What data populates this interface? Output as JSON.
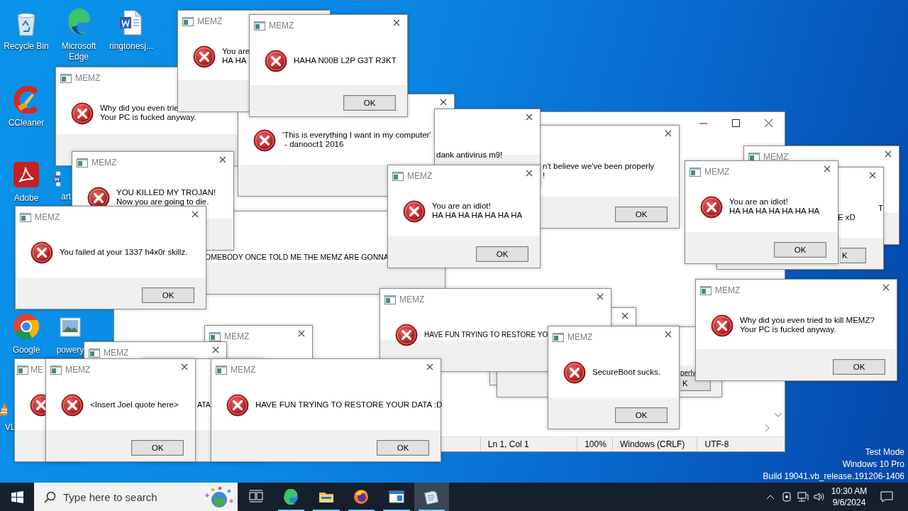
{
  "desktop_icons": [
    {
      "kind": "recycle",
      "label": "Recycle Bin"
    },
    {
      "kind": "edge",
      "label": "Microsoft Edge"
    },
    {
      "kind": "word",
      "label": "ringtonesj..."
    },
    {
      "kind": "ccleaner",
      "label": "CCleaner"
    },
    {
      "kind": "acrobat",
      "label": "Adobe"
    },
    {
      "kind": "word",
      "label": "art"
    },
    {
      "kind": "chrome",
      "label": "Google"
    },
    {
      "kind": "image",
      "label": "powery"
    },
    {
      "kind": "vlc",
      "label": "VL"
    }
  ],
  "notepad": {
    "status_bar": [
      "Ln 1, Col 1",
      "100%",
      "Windows (CRLF)",
      "UTF-8"
    ]
  },
  "message_boxes": [
    {
      "title": "MEMZ",
      "close": true,
      "error_icon": false
    },
    {
      "close": true,
      "error_icon": false,
      "lines": [
        "T",
        "E xD"
      ],
      "ok": "K"
    },
    {
      "title": "MEMZ",
      "close": true,
      "error_icon": true,
      "lines": [
        "You are an idiot!",
        "HA HA HA HA HA HA HA"
      ],
      "ok": "OK"
    },
    {
      "title": "MEMZ",
      "close": false,
      "error_icon": true,
      "lines": [
        "Why did you even trie",
        "Your PC is fucked anyway."
      ]
    },
    {
      "close": true,
      "error_icon": true,
      "lines": [
        "'This is everything I want in my computer'",
        " - danooct1 2016"
      ]
    },
    {
      "title": "MEMZ",
      "close": false,
      "error_icon": true,
      "lines": [
        "You are",
        "HA HA"
      ]
    },
    {
      "title": "MEMZ",
      "close": true,
      "error_icon": true,
      "lines": [
        "HAHA N00B L2P G3T R3KT"
      ],
      "ok": "OK"
    },
    {
      "close": true,
      "error_icon": false,
      "lines": [
        "n't believe we've been properly",
        "!"
      ],
      "ok": "OK"
    },
    {
      "close": true,
      "error_icon": false,
      "lines": [
        "dank antivirus m9!"
      ]
    },
    {
      "close": false,
      "error_icon": false,
      "lines": [
        "OMEBODY ONCE TOLD ME THE MEMZ ARE GONNA"
      ]
    },
    {
      "title": "MEMZ",
      "close": true,
      "error_icon": true,
      "lines": [
        "YOU KILLED MY TROJAN!",
        "Now you are going to die."
      ]
    },
    {
      "title": "MEMZ",
      "close": true,
      "error_icon": true,
      "lines": [
        "You failed at your 1337 h4x0r skillz."
      ],
      "ok": "OK"
    },
    {
      "title": "MEMZ",
      "close": true,
      "error_icon": true,
      "lines": [
        "You are an idiot!",
        "HA HA HA HA HA HA HA"
      ],
      "ok": "OK"
    },
    {
      "close": true,
      "error_icon": false
    },
    {
      "close": false,
      "error_icon": false,
      "lines": [
        "perly"
      ],
      "ok": "K"
    },
    {
      "title": "MEMZ",
      "close": true,
      "error_icon": true,
      "lines": [
        "HAVE FUN TRYING TO RESTORE YO"
      ]
    },
    {
      "title": "MEMZ",
      "close": true,
      "error_icon": true,
      "lines": [
        "SecureBoot sucks."
      ],
      "ok": "OK"
    },
    {
      "title": "MEMZ",
      "close": true,
      "error_icon": true,
      "lines": [
        "Why did you even tried to kill MEMZ?",
        "Your PC is fucked anyway."
      ],
      "ok": "OK"
    },
    {
      "title": "MEMZ",
      "close": true,
      "error_icon": false
    },
    {
      "title": "MEMZ",
      "close": true,
      "error_icon": false
    },
    {
      "title": "ME",
      "close": false,
      "error_icon": true
    },
    {
      "title": "MEMZ",
      "close": true,
      "error_icon": true,
      "lines": [
        "<Insert Joel quote here>"
      ],
      "ok": "OK"
    },
    {
      "close": false,
      "error_icon": false,
      "lines": [
        "ATA"
      ]
    },
    {
      "title": "MEMZ",
      "close": true,
      "error_icon": true,
      "lines": [
        "HAVE FUN TRYING TO RESTORE YOUR DATA :D"
      ],
      "ok": "OK"
    }
  ],
  "system_notice": [
    "Test Mode",
    "Windows 10 Pro",
    "Build 19041.vb_release.191206-1406"
  ],
  "taskbar": {
    "search": {
      "placeholder": "Type here to search"
    },
    "apps": [
      {
        "kind": "task-view",
        "running": false,
        "selected": false
      },
      {
        "kind": "edge",
        "running": true,
        "selected": false
      },
      {
        "kind": "explorer",
        "running": true,
        "selected": false
      },
      {
        "kind": "firefox",
        "running": true,
        "selected": false
      },
      {
        "kind": "window-app",
        "running": true,
        "selected": false
      },
      {
        "kind": "notepad",
        "running": true,
        "selected": true
      }
    ],
    "clock": {
      "time": "10:30 AM",
      "date": "9/6/2024"
    }
  }
}
